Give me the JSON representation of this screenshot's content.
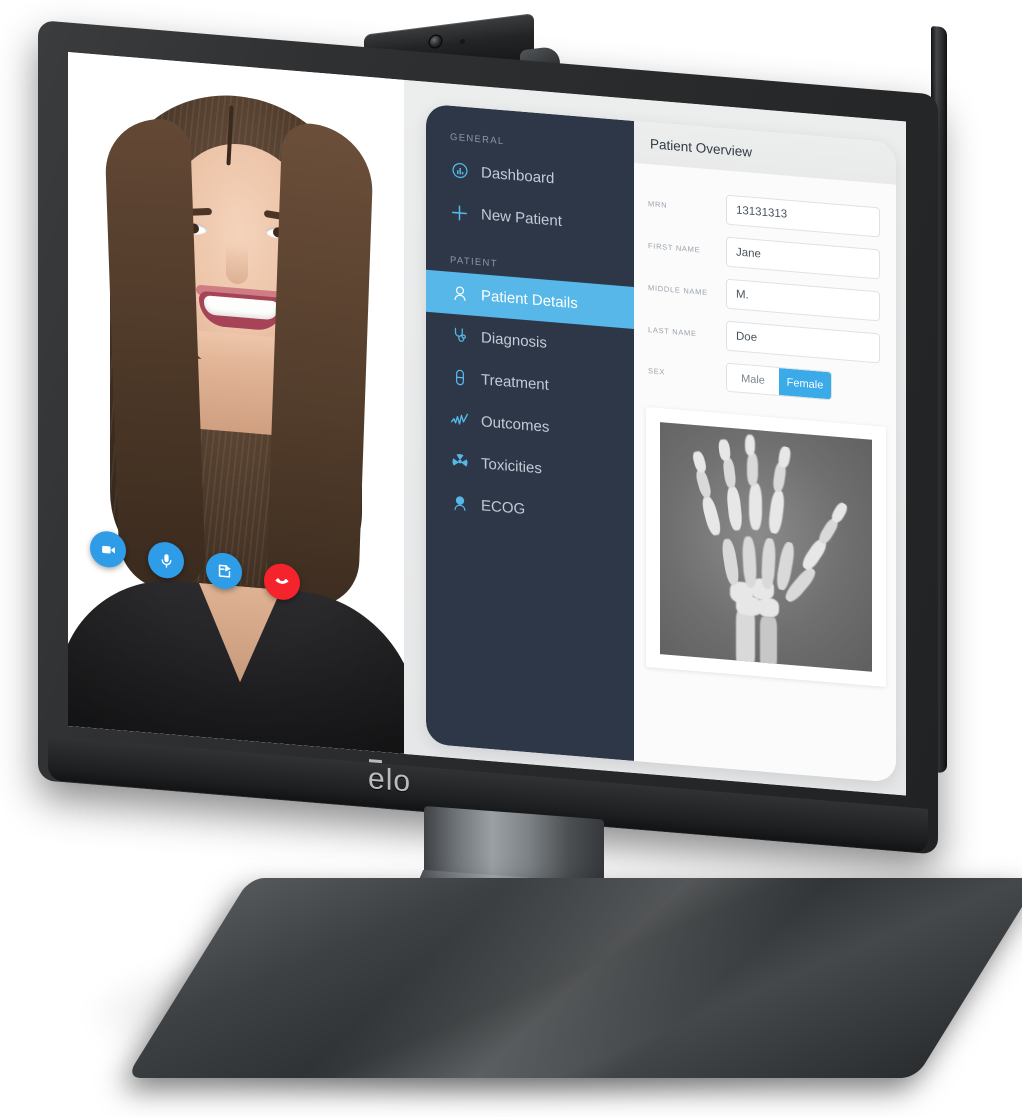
{
  "device": {
    "brand_logo": "elo",
    "brand_logo_name": "elo-logo",
    "webcam": "webcam-module"
  },
  "video_call": {
    "participant_alt": "smiling woman on video call",
    "controls": [
      {
        "name": "camera-toggle-button",
        "icon": "video-camera-icon",
        "color": "#2f9ce8",
        "label": "Camera"
      },
      {
        "name": "microphone-toggle-button",
        "icon": "microphone-icon",
        "color": "#2f9ce8",
        "label": "Microphone"
      },
      {
        "name": "share-screen-button",
        "icon": "share-screen-icon",
        "color": "#2f9ce8",
        "label": "Share"
      },
      {
        "name": "end-call-button",
        "icon": "phone-hangup-icon",
        "color": "#f5232c",
        "label": "End call"
      }
    ]
  },
  "sidebar": {
    "groups": [
      {
        "label": "GENERAL",
        "items": [
          {
            "label": "Dashboard",
            "icon": "dashboard-chart-icon",
            "active": false
          },
          {
            "label": "New Patient",
            "icon": "plus-icon",
            "active": false
          }
        ]
      },
      {
        "label": "PATIENT",
        "items": [
          {
            "label": "Patient Details",
            "icon": "person-outline-icon",
            "active": true
          },
          {
            "label": "Diagnosis",
            "icon": "stethoscope-icon",
            "active": false
          },
          {
            "label": "Treatment",
            "icon": "pill-capsule-icon",
            "active": false
          },
          {
            "label": "Outcomes",
            "icon": "line-chart-icon",
            "active": false
          },
          {
            "label": "Toxicities",
            "icon": "radiation-icon",
            "active": false
          },
          {
            "label": "ECOG",
            "icon": "person-filled-icon",
            "active": false
          }
        ]
      }
    ],
    "active_color": "#56b7e8",
    "bg_color": "#2d3748"
  },
  "content": {
    "header_title": "Patient Overview",
    "fields": [
      {
        "label": "MRN",
        "value": "13131313"
      },
      {
        "label": "FIRST NAME",
        "value": "Jane"
      },
      {
        "label": "MIDDLE NAME",
        "value": "M."
      },
      {
        "label": "LAST NAME",
        "value": "Doe"
      }
    ],
    "sex": {
      "label": "SEX",
      "options": [
        "Male",
        "Female"
      ],
      "selected": "Female",
      "selected_color": "#3aabe8"
    },
    "image_card": {
      "name": "hand-xray-image",
      "alt": "X-ray radiograph of a human right hand"
    }
  }
}
